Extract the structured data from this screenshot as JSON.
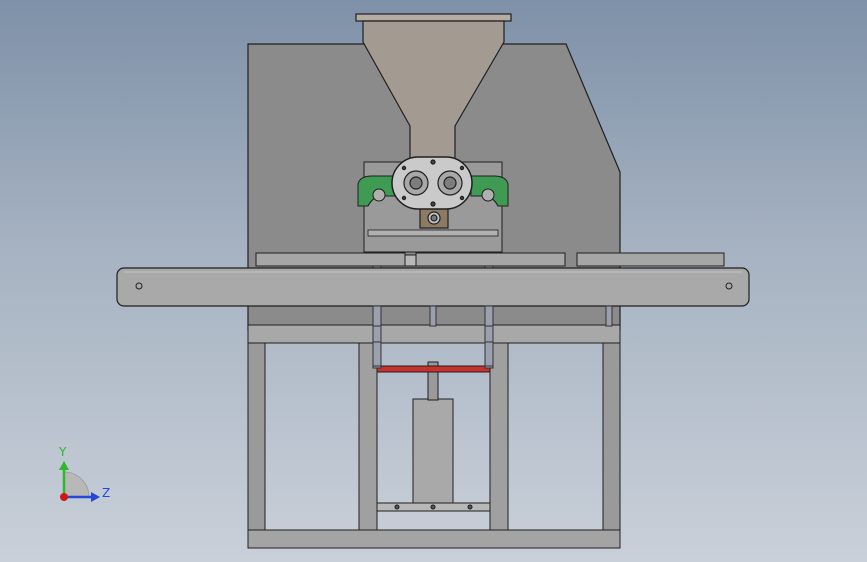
{
  "viewport": {
    "model": "cad-machine-assembly-front-view",
    "view_orientation": "front",
    "background_style": "gradient-blue-gray"
  },
  "triad": {
    "y_label": "Y",
    "z_label": "Z",
    "colors": {
      "y": "#2eb82e",
      "z": "#2548d6",
      "x": "#d01818"
    }
  },
  "colors": {
    "body_gray": "#8a8a8a",
    "frame_gray": "#9e9e9e",
    "hopper": "#a39a92",
    "pump_body": "#c9c9c9",
    "green_bracket": "#3f9a54",
    "red_bar": "#c8312e",
    "edge": "#1f1f1f"
  }
}
